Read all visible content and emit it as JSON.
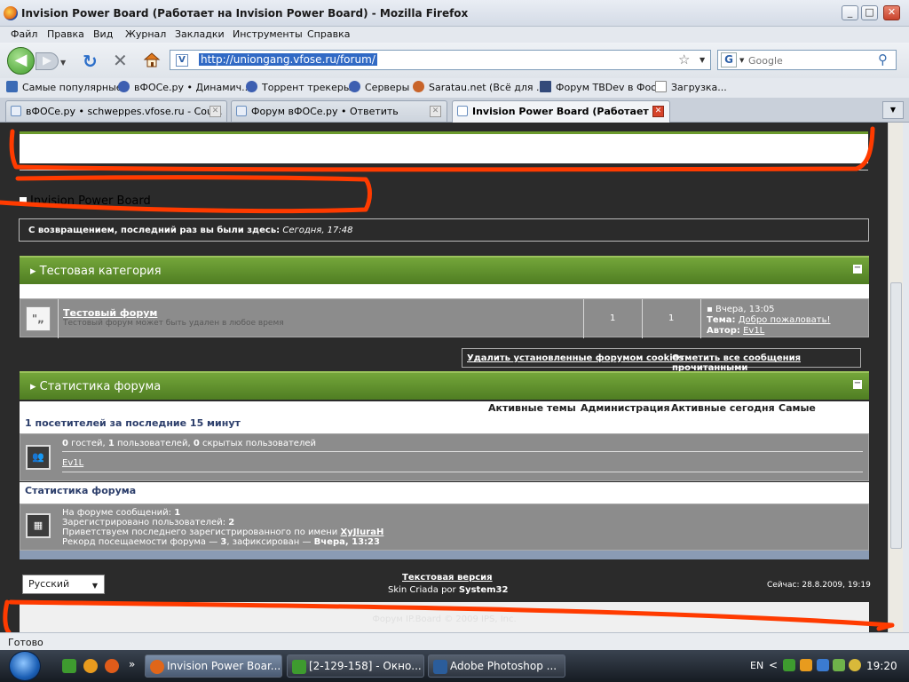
{
  "window": {
    "title": "Invision Power Board (Работает на Invision Power Board) - Mozilla Firefox",
    "minimize": "_",
    "maximize": "□",
    "close": "✕"
  },
  "menu": [
    "Файл",
    "Правка",
    "Вид",
    "Журнал",
    "Закладки",
    "Инструменты",
    "Справка"
  ],
  "nav": {
    "back_icon": "◀",
    "forward_icon": "▶",
    "reload_icon": "↻",
    "stop_icon": "✕",
    "url": "http://uniongang.vfose.ru/forum/",
    "search_placeholder": "Google",
    "search_engine_icon": "G"
  },
  "bookmarks": [
    "Самые популярные",
    "вФОСе.ру • Динамич...",
    "Торрент трекеры",
    "Серверы",
    "Saratau.net (Всё для ...",
    "Форум TBDev в Фосе",
    "Загрузка..."
  ],
  "tabs": [
    {
      "label": "вФОСе.ру • schweppes.vfose.ru - Cou...",
      "active": false
    },
    {
      "label": "Форум вФОСе.ру • Ответить",
      "active": false
    },
    {
      "label": "Invision Power Board (Работает ...",
      "active": true
    }
  ],
  "forum": {
    "board_title": "Invision Power Board",
    "welcome_label": "С возвращением, последний раз вы были здесь:",
    "welcome_time": "Сегодня, 17:48",
    "category": "Тестовая категория",
    "forum_name": "Тестовый форум",
    "forum_desc": "Тестовый форум может быть удален в любое время",
    "forum_icon": "\"„",
    "topics": "1",
    "replies": "1",
    "last_post_date": "Вчера, 13:05",
    "last_post_topic_label": "Тема:",
    "last_post_topic": "Добро пожаловать!",
    "last_post_author_label": "Автор:",
    "last_post_author": "Ev1L",
    "delete_cookies": "Удалить установленные форумом cookies",
    "mark_read": "Отметить все сообщения прочитанными",
    "stats_header": "Статистика форума",
    "stat_links": [
      "Активные темы",
      "Администрация",
      "Активные сегодня",
      "Самые активные"
    ],
    "online_header": "1 посетителей за последние 15 минут",
    "online_guests": "0",
    "online_guests_label": "гостей,",
    "online_users": "1",
    "online_users_label": "пользователей,",
    "online_hidden": "0",
    "online_hidden_label": "скрытых пользователей",
    "online_user": "Ev1L",
    "forum_stats_header": "Статистика форума",
    "posts_label": "На форуме сообщений:",
    "posts": "1",
    "registered_label": "Зарегистрировано пользователей:",
    "registered": "2",
    "newest_label": "Приветствуем последнего зарегистрированного по имени",
    "newest": "XyJIuraH",
    "record_label": "Рекорд посещаемости форума —",
    "record_count": "3",
    "record_mid": ", зафиксирован —",
    "record_date": "Вчера, 13:23",
    "language": "Русский",
    "text_version": "Текстовая версия",
    "skin_label": "Skin Criada por",
    "skin_author": "System32",
    "now": "Сейчас: 28.8.2009, 19:19",
    "copyright": "Форум IP.Board © 2009  IPS, Inc."
  },
  "status": "Готово",
  "taskbar": {
    "buttons": [
      "Invision Power Boar...",
      "[2-129-158] - Окно...",
      "Adobe Photoshop ..."
    ],
    "lang": "EN",
    "clock": "19:20",
    "more": "»"
  },
  "colors": {
    "green_header": "#5b8a2a",
    "red_marker": "#ff3b00",
    "content_bg": "#2b2b2b"
  }
}
